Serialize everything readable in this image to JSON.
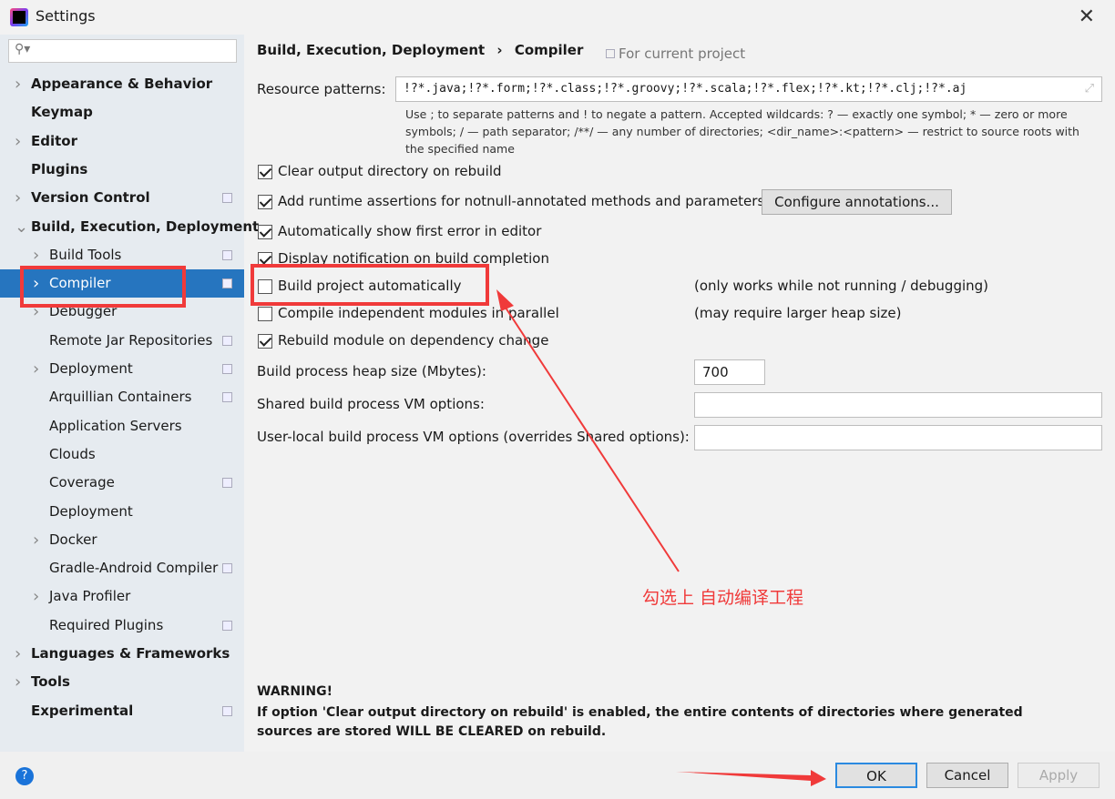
{
  "window": {
    "title": "Settings",
    "close": "✕"
  },
  "sidebar": {
    "search_placeholder": "",
    "items": [
      {
        "label": "Appearance & Behavior",
        "level": 0,
        "expandable": true
      },
      {
        "label": "Keymap",
        "level": 0
      },
      {
        "label": "Editor",
        "level": 0,
        "expandable": true
      },
      {
        "label": "Plugins",
        "level": 0
      },
      {
        "label": "Version Control",
        "level": 0,
        "expandable": true,
        "project": true
      },
      {
        "label": "Build, Execution, Deployment",
        "level": 0,
        "expanded": true
      },
      {
        "label": "Build Tools",
        "level": 1,
        "expandable": true,
        "project": true
      },
      {
        "label": "Compiler",
        "level": 1,
        "expandable": true,
        "project": true,
        "selected": true
      },
      {
        "label": "Debugger",
        "level": 1,
        "expandable": true
      },
      {
        "label": "Remote Jar Repositories",
        "level": 1,
        "project": true
      },
      {
        "label": "Deployment",
        "level": 1,
        "expandable": true,
        "project": true
      },
      {
        "label": "Arquillian Containers",
        "level": 1,
        "project": true
      },
      {
        "label": "Application Servers",
        "level": 1
      },
      {
        "label": "Clouds",
        "level": 1
      },
      {
        "label": "Coverage",
        "level": 1,
        "project": true
      },
      {
        "label": "Deployment",
        "level": 1
      },
      {
        "label": "Docker",
        "level": 1,
        "expandable": true
      },
      {
        "label": "Gradle-Android Compiler",
        "level": 1,
        "project": true
      },
      {
        "label": "Java Profiler",
        "level": 1,
        "expandable": true
      },
      {
        "label": "Required Plugins",
        "level": 1,
        "project": true
      },
      {
        "label": "Languages & Frameworks",
        "level": 0,
        "expandable": true
      },
      {
        "label": "Tools",
        "level": 0,
        "expandable": true
      },
      {
        "label": "Experimental",
        "level": 0,
        "project": true
      }
    ]
  },
  "header": {
    "crumb1": "Build, Execution, Deployment",
    "sep": "›",
    "crumb2": "Compiler",
    "scope": "For current project"
  },
  "resource": {
    "label": "Resource patterns:",
    "value": "!?*.java;!?*.form;!?*.class;!?*.groovy;!?*.scala;!?*.flex;!?*.kt;!?*.clj;!?*.aj",
    "hint": "Use ; to separate patterns and ! to negate a pattern. Accepted wildcards: ? — exactly one symbol; * — zero or more symbols; / — path separator; /**/ — any number of directories; <dir_name>:<pattern> — restrict to source roots with the specified name"
  },
  "options": [
    {
      "label": "Clear output directory on rebuild",
      "checked": true
    },
    {
      "label": "Add runtime assertions for notnull-annotated methods and parameters",
      "checked": true
    },
    {
      "label": "Automatically show first error in editor",
      "checked": true
    },
    {
      "label": "Display notification on build completion",
      "checked": true
    },
    {
      "label": "Build project automatically",
      "checked": false,
      "note": "(only works while not running / debugging)"
    },
    {
      "label": "Compile independent modules in parallel",
      "checked": false,
      "note": "(may require larger heap size)"
    },
    {
      "label": "Rebuild module on dependency change",
      "checked": true
    }
  ],
  "configure_annotations": "Configure annotations...",
  "heap": {
    "label": "Build process heap size (Mbytes):",
    "value": "700"
  },
  "shared_vm": {
    "label": "Shared build process VM options:",
    "value": ""
  },
  "local_vm": {
    "label": "User-local build process VM options (overrides Shared options):",
    "value": ""
  },
  "warning": {
    "title": "WARNING!",
    "text": "If option 'Clear output directory on rebuild' is enabled, the entire contents of directories where generated sources are stored WILL BE CLEARED on rebuild."
  },
  "annotation": {
    "text": "勾选上  自动编译工程",
    "color": "#f03a3a"
  },
  "buttons": {
    "help": "?",
    "ok": "OK",
    "cancel": "Cancel",
    "apply": "Apply"
  }
}
